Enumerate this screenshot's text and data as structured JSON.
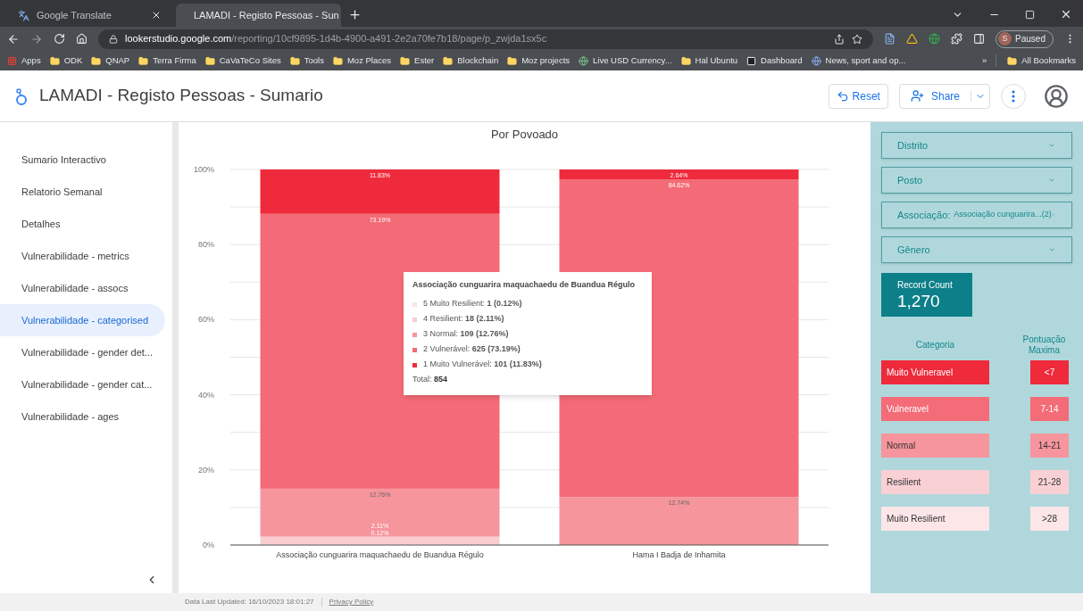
{
  "browser": {
    "tabs": [
      {
        "title": "Google Translate",
        "selected": false
      },
      {
        "title": "LAMADI - Registo Pessoas - Sun",
        "selected": true
      }
    ],
    "url": {
      "host": "lookerstudio.google.com",
      "path": "/reporting/10cf9895-1d4b-4900-a491-2e2a70fe7b18/page/p_zwjda1sx5c"
    },
    "profile": {
      "initial": "S",
      "status": "Paused"
    },
    "bookmarks": [
      {
        "label": "Apps",
        "kind": "apps"
      },
      {
        "label": "ODK",
        "kind": "folder"
      },
      {
        "label": "QNAP",
        "kind": "folder"
      },
      {
        "label": "Terra Firma",
        "kind": "folder"
      },
      {
        "label": "CaVaTeCo Sites",
        "kind": "folder"
      },
      {
        "label": "Tools",
        "kind": "folder"
      },
      {
        "label": "Moz Places",
        "kind": "folder"
      },
      {
        "label": "Ester",
        "kind": "folder"
      },
      {
        "label": "Blockchain",
        "kind": "folder"
      },
      {
        "label": "Moz projects",
        "kind": "folder"
      },
      {
        "label": "Live USD Currency...",
        "kind": "globe"
      },
      {
        "label": "Hal Ubuntu",
        "kind": "folder"
      },
      {
        "label": "Dashboard",
        "kind": "badge"
      },
      {
        "label": "News, sport and op...",
        "kind": "news"
      }
    ],
    "more_bookmarks": "»",
    "all_bookmarks": "All Bookmarks"
  },
  "report": {
    "title": "LAMADI - Registo Pessoas - Sumario",
    "reset": "Reset",
    "share": "Share"
  },
  "sidebar": {
    "items": [
      {
        "label": "Sumario Interactivo",
        "selected": false
      },
      {
        "label": "Relatorio Semanal",
        "selected": false
      },
      {
        "label": "Detalhes",
        "selected": false
      },
      {
        "label": "Vulnerabilidade - metrics",
        "selected": false
      },
      {
        "label": "Vulnerabilidade - assocs",
        "selected": false
      },
      {
        "label": "Vulnerabilidade - categorised",
        "selected": true
      },
      {
        "label": "Vulnerabilidade - gender det...",
        "selected": false
      },
      {
        "label": "Vulnerabilidade - gender cat...",
        "selected": false
      },
      {
        "label": "Vulnerabilidade - ages",
        "selected": false
      }
    ]
  },
  "chart": {
    "title": "Por Povoado",
    "chart_data": {
      "type": "bar",
      "stacked": true,
      "grid": true,
      "categories": [
        "Associação cunguarira maquachaedu de Buandua Régulo",
        "Hama I Badja de Inhamita"
      ],
      "series": [
        {
          "name": "5 Muito Resilient",
          "color": "#fbe3e6",
          "values": [
            0.12,
            0
          ]
        },
        {
          "name": "4 Resilient",
          "color": "#f9cdd2",
          "values": [
            2.11,
            0
          ]
        },
        {
          "name": "3 Normal",
          "color": "#f6959c",
          "values": [
            12.76,
            12.74
          ]
        },
        {
          "name": "2 Vulnerável",
          "color": "#f36b76",
          "values": [
            73.19,
            84.62
          ]
        },
        {
          "name": "1 Muito Vulnerável",
          "color": "#ef2a3c",
          "values": [
            11.83,
            2.64
          ]
        }
      ],
      "value_labels": [
        [
          "0.12%",
          null
        ],
        [
          "2.11%",
          null
        ],
        [
          "12.76%",
          "12.74%"
        ],
        [
          "73.19%",
          "84.62%"
        ],
        [
          "11.83%",
          "2.64%"
        ]
      ],
      "ylim": [
        0,
        100
      ],
      "yticks": [
        {
          "value": 0,
          "label": "0%"
        },
        {
          "value": 20,
          "label": "20%"
        },
        {
          "value": 40,
          "label": "40%"
        },
        {
          "value": 60,
          "label": "60%"
        },
        {
          "value": 80,
          "label": "80%"
        },
        {
          "value": 100,
          "label": "100%"
        }
      ]
    },
    "tooltip": {
      "title": "Associação cunguarira maquachaedu de Buandua Régulo",
      "values": [
        ": **1 (0.12%)**",
        ": **18 (2.11%)**",
        ": **109 (12.76%)**",
        ": **625 (73.19%)**",
        ": **101 (11.83%)**"
      ],
      "total": {
        "label": "Total:",
        "value": "854"
      }
    }
  },
  "filters": [
    {
      "label": "Distrito"
    },
    {
      "label": "Posto"
    },
    {
      "label": "Associação:",
      "value": "Associação cunguarira...(2)"
    },
    {
      "label": "Gênero"
    }
  ],
  "record_count": {
    "label": "Record Count",
    "value": "1,270"
  },
  "legend_table": {
    "columns": [
      "Categoria",
      "Pontuação Maxima"
    ],
    "rows": [
      {
        "category": "Muito Vulneravel",
        "score": "<7",
        "color": "#ee2a3b"
      },
      {
        "category": "Vulneravel",
        "score": "7-14",
        "color": "#f36c77"
      },
      {
        "category": "Normal",
        "score": "14-21",
        "color": "#f6959d"
      },
      {
        "category": "Resilient",
        "score": "21-28",
        "color": "#f9d1d5"
      },
      {
        "category": "Muito Resilient",
        "score": ">28",
        "color": "#fce6e8"
      }
    ]
  },
  "footer": {
    "updated": "Data Last Updated: 16/10/2023 18:01:27",
    "privacy": "Privacy Policy"
  }
}
